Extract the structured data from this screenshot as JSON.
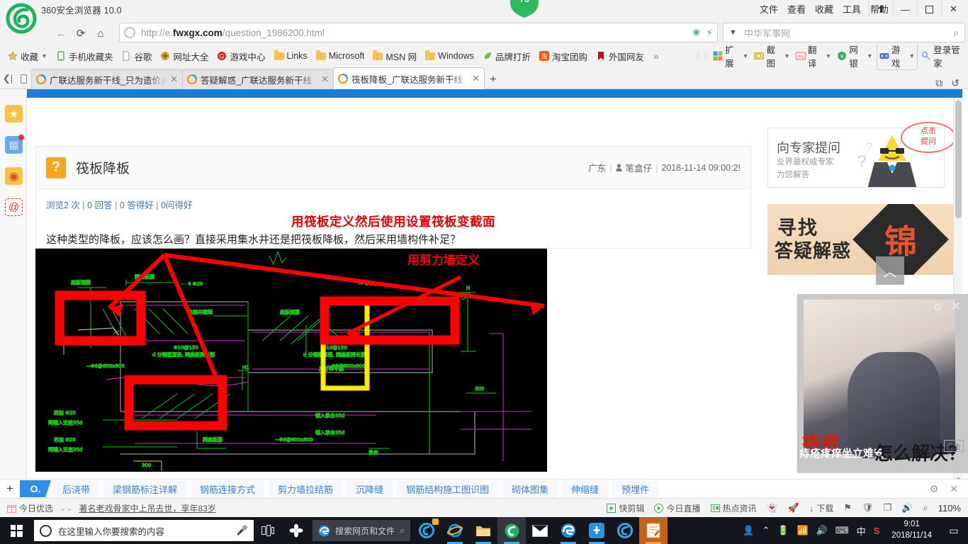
{
  "browser": {
    "name": "360安全浏览器 10.0",
    "window_menu": [
      "文件",
      "查看",
      "收藏",
      "工具",
      "帮助"
    ],
    "window_buttons": [
      "pin",
      "minimize",
      "maximize",
      "close"
    ],
    "score_badge": "73",
    "nav": {
      "back": "←",
      "reload": "⟳",
      "home": "⌂"
    },
    "url": {
      "prefix": "http://e.",
      "domain": "fwxgx.com",
      "path": "/question_1986200.html"
    },
    "search": {
      "placeholder": "中华军事网"
    },
    "bookmarks": [
      {
        "label": "收藏",
        "icon": "star-icon"
      },
      {
        "label": "手机收藏夹",
        "icon": "phone-icon"
      },
      {
        "label": "谷歌",
        "icon": "page-icon"
      },
      {
        "label": "网址大全",
        "icon": "plus-circle-icon"
      },
      {
        "label": "游戏中心",
        "icon": "g-circle-icon"
      },
      {
        "label": "Links",
        "icon": "folder-icon"
      },
      {
        "label": "Microsoft",
        "icon": "folder-icon"
      },
      {
        "label": "MSN 网",
        "icon": "folder-icon"
      },
      {
        "label": "Windows",
        "icon": "folder-icon"
      },
      {
        "label": "品牌打折",
        "icon": "leaf-icon"
      },
      {
        "label": "淘宝团购",
        "icon": "taobao-icon"
      },
      {
        "label": "外国网友",
        "icon": "flag-icon"
      }
    ],
    "bookmarks_overflow": "»",
    "tools": [
      {
        "label": "扩展",
        "icon": "extension-icon"
      },
      {
        "label": "截图",
        "icon": "screenshot-icon"
      },
      {
        "label": "翻译",
        "icon": "translate-icon"
      },
      {
        "label": "网银",
        "icon": "bank-shield-icon"
      },
      {
        "label": "游戏",
        "icon": "gamepad-icon"
      },
      {
        "label": "登录管家",
        "icon": "key-icon"
      }
    ],
    "tabs": [
      {
        "title": "广联达服务新干线_只为造价从业",
        "active": false
      },
      {
        "title": "答疑解惑_广联达服务新干线",
        "active": false
      },
      {
        "title": "筏板降板_广联达服务新干线",
        "active": true
      }
    ],
    "new_tab": "+"
  },
  "rail": [
    {
      "name": "favorites-icon",
      "glyph": "★"
    },
    {
      "name": "news-icon",
      "glyph": "▤"
    },
    {
      "name": "weibo-icon",
      "glyph": "◉"
    },
    {
      "name": "mail-icon",
      "glyph": "@"
    }
  ],
  "page": {
    "post": {
      "badge": "?",
      "title": "筏板降板",
      "region": "广东",
      "author": "笔盒仔",
      "datetime": "2018-11-14 09:00:2!"
    },
    "stats": {
      "views": "浏览2 次",
      "answers": "0 回答",
      "good_answers": "0 答得好",
      "good_questions": "0问得好",
      "sep": "|"
    },
    "red_note": "用筏板定义然后使用设置筏板变截面",
    "question": "这种类型的降板，应该怎么画？直接采用集水井还是把筏板降板，然后采用墙构件补足？",
    "cad": {
      "annotation_yellow": "用剪力墙定义",
      "labels": [
        "底板钢筋",
        "同底板筋",
        "4 Φ20",
        "4 Φ20",
        "电梯井壁墙",
        "底板钢筋",
        "Φ10@150",
        "d 分钢筋直径, 同底板两长筋",
        "Φ10@150",
        "d 分钢筋直径, 同底板两长筋",
        "∽Φ6@600x600",
        "∽Φ6@600x600",
        "∽Φ6@600x600",
        "H1",
        "H",
        "另加 Φ20",
        "两端入支座35d",
        "另加 Φ20",
        "两端入支座35d",
        "锚入承台35d",
        "锚入承台35d",
        "同底板筋",
        "尺寸详平面",
        "300",
        "300",
        "承台"
      ]
    },
    "ads": {
      "expert": {
        "title": "向专家提问",
        "sub1": "业界最权威专家",
        "sub2": "为您解答",
        "bubble": "点击\n提问"
      },
      "jin": {
        "line1": "寻找",
        "line2": "答疑解惑",
        "diamond": "锦"
      },
      "popup": {
        "red_text": "痔疮",
        "white_text": "痔疮疼痒坐立难安",
        "black_text": "怎么解决？",
        "ad_label": "广告",
        "gear": "gear-icon",
        "close": "×"
      },
      "to_top": "︿"
    }
  },
  "hotbar": {
    "plus": "+",
    "tag": "O.",
    "items": [
      "后浇带",
      "梁钢筋标注详解",
      "钢筋连接方式",
      "剪力墙拉结筋",
      "沉降缝",
      "钢筋结构施工图识图",
      "砌体图集",
      "伸缩缝",
      "预埋件"
    ],
    "settings_icon": "gear-icon",
    "close_icon": "×"
  },
  "statusbar": {
    "gift_label": "今日优选",
    "expand": "�ski",
    "news": "著名老戏骨家中上吊去世，享年83岁",
    "right_items": [
      {
        "label": "快剪辑",
        "icon": "video-edit-icon"
      },
      {
        "label": "今日直播",
        "icon": "live-icon"
      },
      {
        "label": "热点资讯",
        "icon": "hotnews-icon"
      },
      {
        "label": "",
        "icon": "ghost-icon"
      },
      {
        "label": "",
        "icon": "rocket-icon"
      },
      {
        "label": "下载",
        "icon": "download-icon"
      },
      {
        "label": "",
        "icon": "flag-icon"
      },
      {
        "label": "",
        "icon": "shield-icon"
      },
      {
        "label": "",
        "icon": "window-icon"
      },
      {
        "label": "",
        "icon": "sound-icon"
      },
      {
        "label": "",
        "icon": "zoom-icon"
      }
    ],
    "zoom": "110%"
  },
  "taskbar": {
    "search_placeholder": "在这里输入你要搜索的内容",
    "mic": "mic-icon",
    "taskview": "taskview-icon",
    "pinned": [
      {
        "name": "cortana-ring-icon"
      },
      {
        "name": "taskview-icon"
      },
      {
        "name": "snowflake-icon"
      },
      {
        "name": "edge-search-icon",
        "label": "搜索网页和文件"
      },
      {
        "name": "360-browser-icon"
      },
      {
        "name": "ie-icon"
      },
      {
        "name": "explorer-icon"
      },
      {
        "name": "360se-icon"
      },
      {
        "name": "mail-icon"
      },
      {
        "name": "edge-icon"
      },
      {
        "name": "cloud-icon"
      },
      {
        "name": "360safe-icon"
      },
      {
        "name": "notepad-icon"
      }
    ],
    "tray": [
      "people-icon",
      "chevron-up-icon",
      "battery-icon",
      "wifi-icon",
      "volume-icon",
      "keyboard-icon",
      "ime-cn",
      "sogou-icon"
    ],
    "clock_time": "9:01",
    "clock_date": "2018/11/14",
    "ime_label": "中",
    "action_center": "action-center-icon"
  },
  "colors": {
    "accent_blue": "#2f8fe8",
    "link_blue": "#3b7fd6",
    "red": "#e60000",
    "yellow": "#ffe600",
    "cad_green": "#18c818",
    "cad_magenta": "#d02fd0",
    "taskbar": "#13161c"
  }
}
